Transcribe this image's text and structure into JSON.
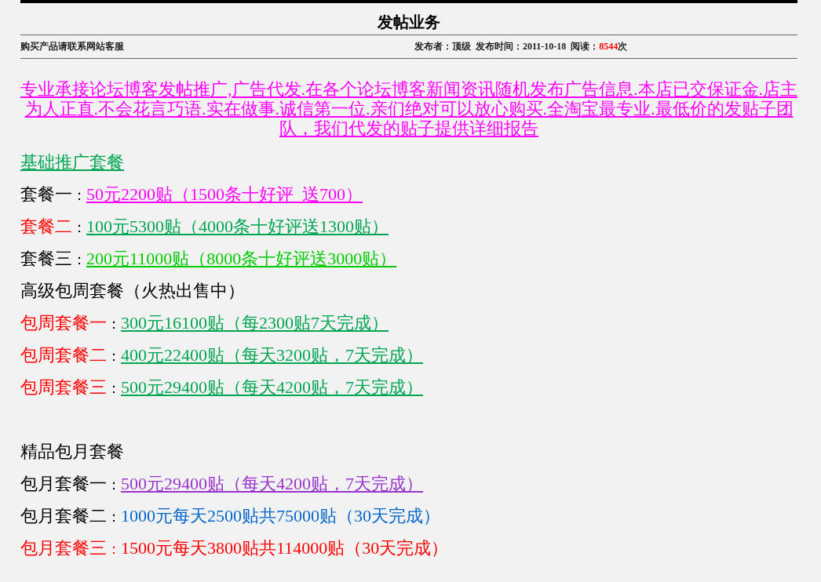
{
  "title": "发帖业务",
  "meta": {
    "note": "购买产品请联系网站客服",
    "publisher": "发布者：顶级",
    "date": "发布时间：2011-10-18",
    "reads_label": "阅读：",
    "reads": "8544",
    "reads_suffix": "次"
  },
  "intro": "专业承接论坛博客发帖推广,广告代发.在各个论坛博客新闻资讯随机发布广告信息.本店已交保证金.店主为人正直.不会花言巧语.实在做事.诚信第一位.亲们绝对可以放心购买.全淘宝最专业.最低价的发贴子团队，我们代发的贴子提供详细报告",
  "lines": [
    {
      "kind": "link-heading",
      "text": "基础推广套餐",
      "color": "#00a651"
    },
    {
      "kind": "plan",
      "label": {
        "text": "套餐一",
        "color": "#000000"
      },
      "colon": {
        "text": "：",
        "color": "#000000"
      },
      "value": {
        "text": "50元2200贴（1500条十好评  送700）",
        "color": "#ff00ff"
      },
      "link": true
    },
    {
      "kind": "plan",
      "label": {
        "text": "套餐二",
        "color": "#ff0000"
      },
      "colon": {
        "text": "：",
        "color": "#000000"
      },
      "value": {
        "text": "100元5300贴（4000条十好评送1300贴）",
        "color": "#00a651"
      },
      "link": true
    },
    {
      "kind": "plan",
      "label": {
        "text": "套餐三",
        "color": "#000000"
      },
      "colon": {
        "text": "：",
        "color": "#000000"
      },
      "value": {
        "text": "200元11000贴（8000条十好评送3000贴）",
        "color": "#00cc00"
      },
      "link": true
    },
    {
      "kind": "heading",
      "text": "高级包周套餐（火热出售中）",
      "color": "#000000"
    },
    {
      "kind": "plan",
      "label": {
        "text": "包周套餐一",
        "color": "#ff0000"
      },
      "colon": {
        "text": "：",
        "color": "#000000"
      },
      "value": {
        "text": "300元16100贴（每2300贴7天完成）",
        "color": "#00a651"
      },
      "link": true
    },
    {
      "kind": "plan",
      "label": {
        "text": "包周套餐二",
        "color": "#ff0000"
      },
      "colon": {
        "text": "：",
        "color": "#000000"
      },
      "value": {
        "text": "400元22400贴（每天3200贴，7天完成）",
        "color": "#00a651"
      },
      "link": true
    },
    {
      "kind": "plan",
      "label": {
        "text": "包周套餐三",
        "color": "#ff0000"
      },
      "colon": {
        "text": "：",
        "color": "#000000"
      },
      "value": {
        "text": "500元29400贴（每天4200贴，7天完成）",
        "color": "#00a651"
      },
      "link": true
    },
    {
      "kind": "spacer"
    },
    {
      "kind": "heading",
      "text": "精品包月套餐",
      "color": "#000000"
    },
    {
      "kind": "plan",
      "label": {
        "text": "包月套餐一",
        "color": "#000000"
      },
      "colon": {
        "text": "：",
        "color": "#000000"
      },
      "value": {
        "text": "500元29400贴（每天4200贴，7天完成）",
        "color": "#9933cc"
      },
      "link": true
    },
    {
      "kind": "plan",
      "label": {
        "text": "包月套餐二",
        "color": "#000000"
      },
      "colon": {
        "text": "：",
        "color": "#000000"
      },
      "value": {
        "text": "1000元每天2500贴共75000贴（30天完成）",
        "color": "#0066cc"
      },
      "link": false
    },
    {
      "kind": "plan",
      "label": {
        "text": "包月套餐三",
        "color": "#ff0000"
      },
      "colon": {
        "text": "：",
        "color": "#ff0000"
      },
      "value": {
        "text": "1500元每天3800贴共114000贴（30天完成）",
        "color": "#ff0000"
      },
      "link": false
    }
  ]
}
